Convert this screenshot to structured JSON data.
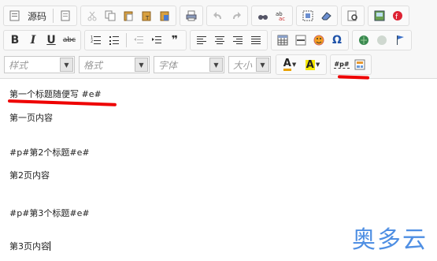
{
  "toolbar": {
    "source_label": "源码",
    "quote_icon": "❞",
    "combo_style": "样式",
    "combo_format": "格式",
    "combo_font": "字体",
    "combo_size": "大小",
    "page_break_label": "#p#",
    "font_color_letter": "A",
    "bg_color_letter": "A"
  },
  "content": {
    "lines": [
      "第一个标题随便写 #e#",
      "第一页内容",
      "#p#第2个标题#e#",
      "第2页内容",
      "#p#第3个标题#e#",
      "第3页内容"
    ]
  },
  "watermark": "奥多云",
  "colors": {
    "annotation": "#ee0000",
    "watermark": "#4f8fe3"
  }
}
